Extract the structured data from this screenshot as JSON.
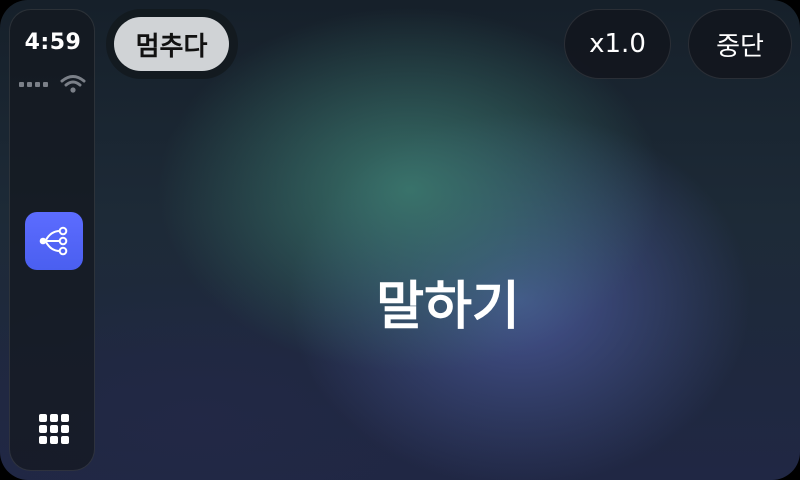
{
  "status": {
    "time": "4:59"
  },
  "sidebar": {
    "app_icon": "share-nodes-icon",
    "app_icon_color": "#5566f5",
    "grid_icon": "app-grid-icon"
  },
  "controls": {
    "pause_label": "멈추다",
    "speed_label": "x1.0",
    "stop_label": "중단"
  },
  "main": {
    "status_label": "말하기"
  }
}
